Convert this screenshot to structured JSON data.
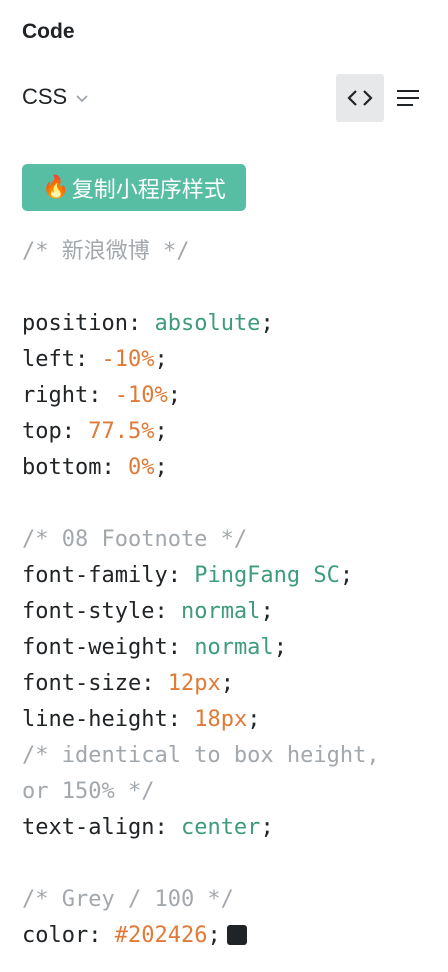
{
  "panel": {
    "title": "Code",
    "language": "CSS",
    "copy_button_icon": "fire-icon",
    "copy_button_label": "复制小程序样式"
  },
  "icons": {
    "code_view": "code-brackets-icon",
    "menu": "list-icon",
    "dropdown": "chevron-down-icon"
  },
  "code": {
    "comment_layer": "/* 新浪微博 */",
    "position_prop": "position",
    "position_val": "absolute",
    "left_prop": "left",
    "left_val": "-10%",
    "right_prop": "right",
    "right_val": "-10%",
    "top_prop": "top",
    "top_val": "77.5%",
    "bottom_prop": "bottom",
    "bottom_val": "0%",
    "comment_style": "/* 08 Footnote */",
    "font_family_prop": "font-family",
    "font_family_val": "PingFang SC",
    "font_style_prop": "font-style",
    "font_style_val": "normal",
    "font_weight_prop": "font-weight",
    "font_weight_val": "normal",
    "font_size_prop": "font-size",
    "font_size_val": "12px",
    "line_height_prop": "line-height",
    "line_height_val": "18px",
    "comment_lh_1": "/* identical to box height,",
    "comment_lh_2": "or 150% */",
    "text_align_prop": "text-align",
    "text_align_val": "center",
    "comment_color": "/* Grey / 100 */",
    "color_prop": "color",
    "color_val": "#202426"
  },
  "colors": {
    "accent": "#58bea3",
    "keyword": "#3e9c7b",
    "number": "#e07a36",
    "comment": "#a3a8ad",
    "swatch": "#202426"
  }
}
